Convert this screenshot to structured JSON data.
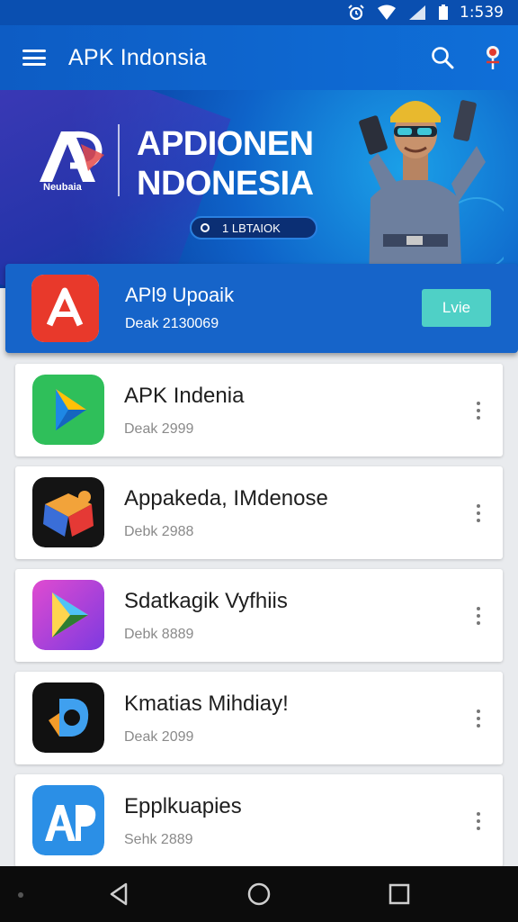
{
  "status_bar": {
    "time": "1:539"
  },
  "app_bar": {
    "title": "APK Indonsia"
  },
  "banner": {
    "logo_caption": "Neubaia",
    "title_line1": "APDIONEN",
    "title_line2": "NDONESIA",
    "pill_text": "1 LBTAIOK"
  },
  "featured": {
    "name": "APl9 Upoaik",
    "subtitle": "Deak 2130069",
    "button_label": "Lvie",
    "icon_color": "#e8392b"
  },
  "apps": [
    {
      "name": "APK Indenia",
      "subtitle": "Deak 2999",
      "icon": "green-play-icon"
    },
    {
      "name": "Appakeda, IMdenose",
      "subtitle": "Debk 2988",
      "icon": "colorful-cube-icon"
    },
    {
      "name": "Sdatkagik Vyfhiis",
      "subtitle": "Debk 8889",
      "icon": "purple-play-icon"
    },
    {
      "name": "Kmatias Mihdiay!",
      "subtitle": "Deak 2099",
      "icon": "blue-d-icon"
    },
    {
      "name": "Epplkuapies",
      "subtitle": "Sehk 2889",
      "icon": "ap-letter-icon"
    }
  ],
  "colors": {
    "primary": "#0d5cc4",
    "accent": "#4fd0c6",
    "nav": "#0c0c0c"
  }
}
